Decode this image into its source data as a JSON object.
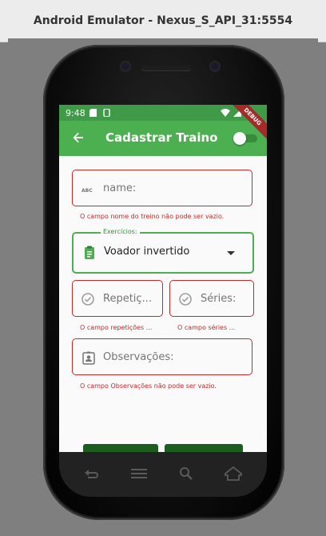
{
  "window": {
    "title": "Android Emulator - Nexus_S_API_31:5554"
  },
  "status_bar": {
    "time": "9:48"
  },
  "app_bar": {
    "title": "Cadastrar Traino",
    "debug_banner": "DEBUG"
  },
  "form": {
    "name": {
      "placeholder": "name:",
      "error": "O campo nome do treino não pode ser vazio."
    },
    "exercicios": {
      "label": "Exercícios:",
      "selected": "Voador invertido"
    },
    "repeticoes": {
      "placeholder": "Repetiç...",
      "error": "O campo repetições ..."
    },
    "series": {
      "placeholder": "Séries:",
      "error": "O campo séries ..."
    },
    "observacoes": {
      "placeholder": "Observações:",
      "error": "O campo Observações não pode ser vazio."
    }
  },
  "colors": {
    "primary": "#4caf50",
    "status": "#3f9b47",
    "error": "#c62828",
    "button": "#1b5e20"
  }
}
